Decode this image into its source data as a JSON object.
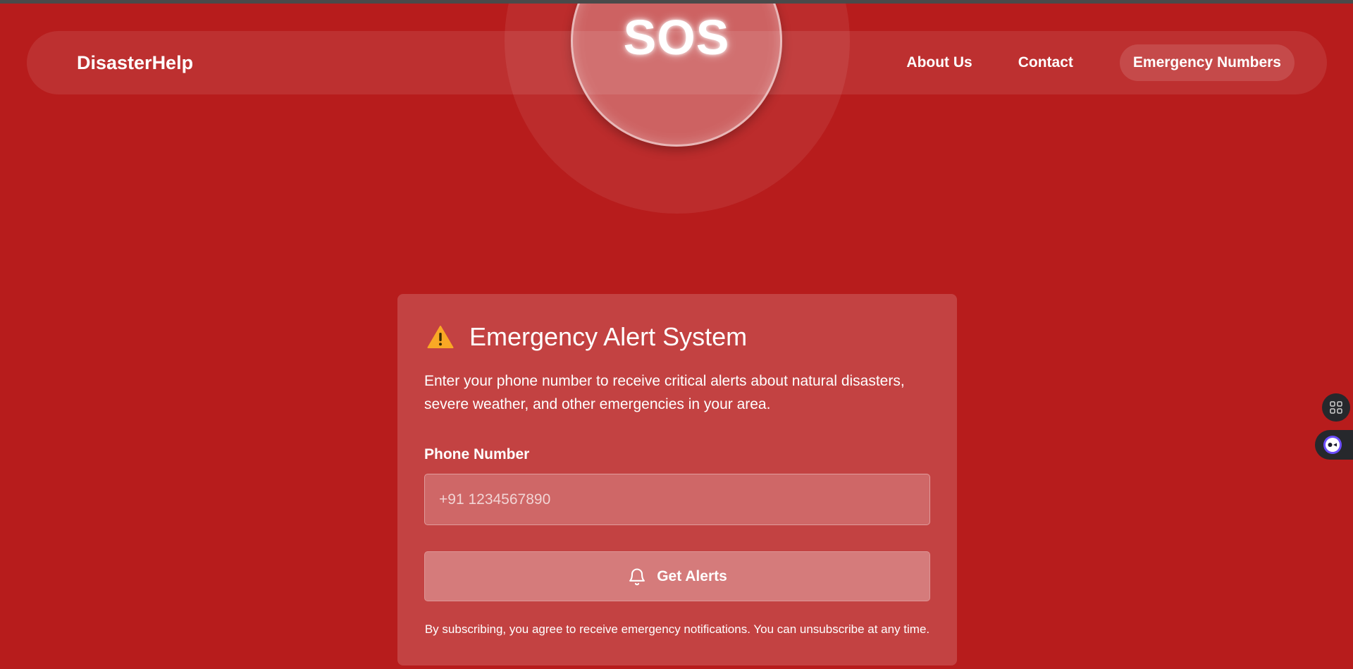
{
  "sos": {
    "label": "SOS"
  },
  "navbar": {
    "brand": "DisasterHelp",
    "links": [
      {
        "label": "About Us"
      },
      {
        "label": "Contact"
      }
    ],
    "emergency_pill": "Emergency Numbers"
  },
  "card": {
    "icon": "warning-icon",
    "title": "Emergency Alert System",
    "description": "Enter your phone number to receive critical alerts about natural disasters, severe weather, and other emergencies in your area.",
    "phone_label": "Phone Number",
    "phone_placeholder": "+91 1234567890",
    "phone_value": "",
    "button_icon": "bell-icon",
    "button_label": "Get Alerts",
    "note": "By subscribing, you agree to receive emergency notifications. You can unsubscribe at any time."
  },
  "side_widgets": [
    {
      "icon": "apps-grid-icon"
    },
    {
      "icon": "assistant-bot-icon"
    }
  ],
  "colors": {
    "background": "#b71c1c",
    "text": "#ffffff",
    "warning": "#f9a825",
    "widget": "#26282c"
  }
}
